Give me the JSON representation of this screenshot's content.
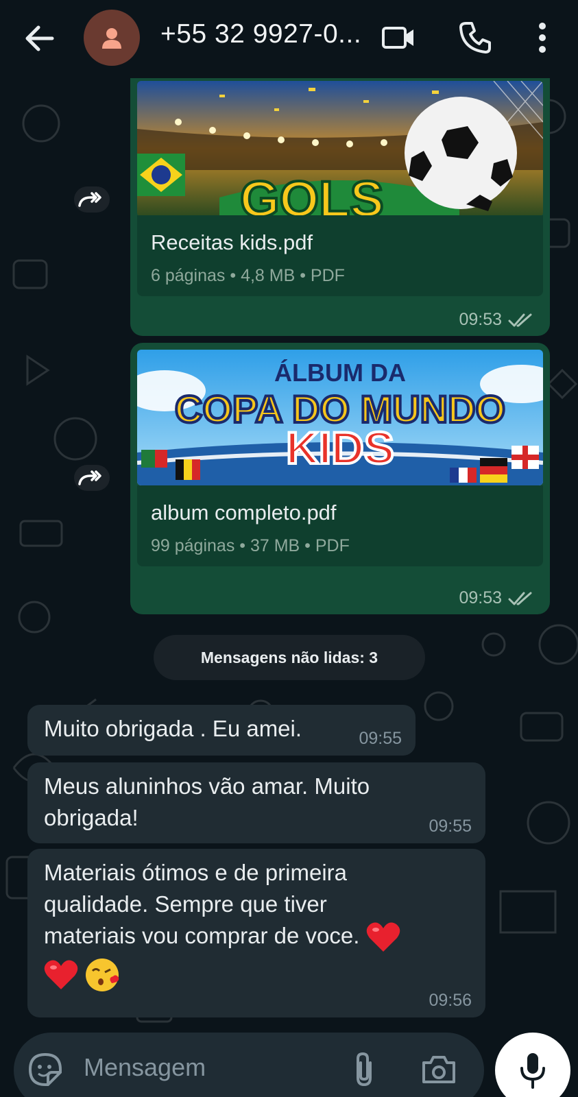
{
  "header": {
    "contact": "+55 32 9927-0...",
    "icons": [
      "back-arrow-icon",
      "person-icon",
      "video-call-icon",
      "phone-icon",
      "more-vert-icon"
    ]
  },
  "messages": {
    "doc1": {
      "filename": "Receitas kids.pdf",
      "meta": "6 páginas • 4,8 MB • PDF",
      "time": "09:53",
      "thumb_text": "GOLS"
    },
    "doc2": {
      "filename": "album completo.pdf",
      "meta": "99 páginas • 37 MB • PDF",
      "time": "09:53",
      "thumb_line1": "ÁLBUM DA",
      "thumb_line2": "COPA DO MUNDO",
      "thumb_line3": "KIDS"
    },
    "unread": "Mensagens não lidas: 3",
    "in1": {
      "text": "Muito obrigada . Eu amei.",
      "time": "09:55"
    },
    "in2": {
      "line1": "Meus aluninhos vão amar. Muito",
      "line2": "obrigada!",
      "time": "09:55"
    },
    "in3": {
      "line1": "Materiais ótimos e de primeira",
      "line2": "qualidade. Sempre que tiver",
      "line3": "materiais vou comprar de voce.",
      "time": "09:56",
      "emojis": [
        "heart-emoji",
        "heart-emoji",
        "kissing-face-emoji"
      ]
    }
  },
  "composer": {
    "placeholder": "Mensagem"
  },
  "colors": {
    "background": "#0b141a",
    "outgoing": "#144d37",
    "incoming": "#202c33",
    "accent": "#25d366"
  }
}
